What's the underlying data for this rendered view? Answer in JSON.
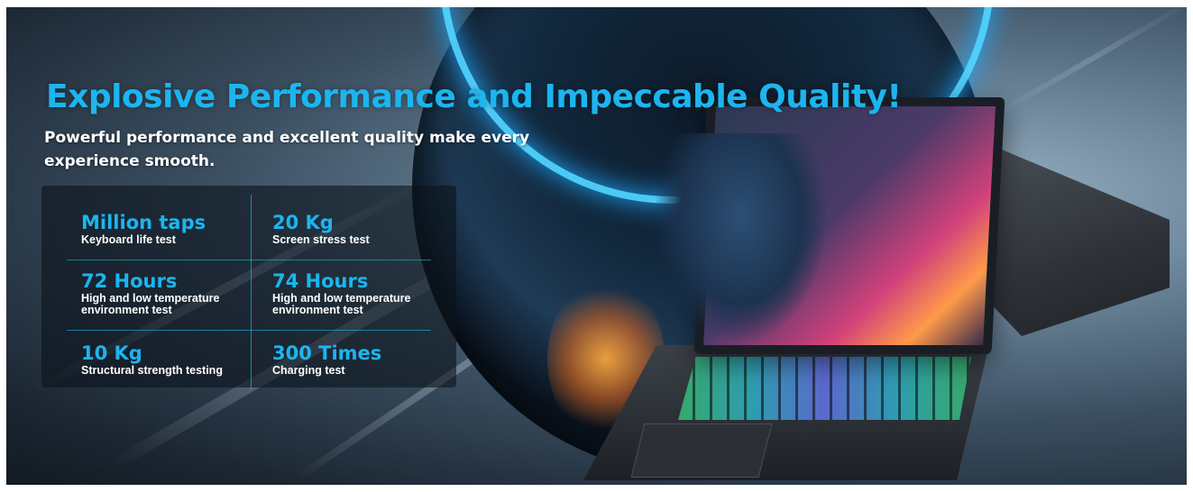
{
  "banner": {
    "headline": "Explosive Performance and Impeccable Quality!",
    "subheadline": "Powerful performance and excellent quality make every experience smooth.",
    "accent_color": "#1cb5ef",
    "text_color": "#ffffff"
  },
  "stats": [
    {
      "value": "Million taps",
      "label": "Keyboard life test"
    },
    {
      "value": "20 Kg",
      "label": "Screen stress test"
    },
    {
      "value": "72 Hours",
      "label": "High and low temperature environment test"
    },
    {
      "value": "74 Hours",
      "label": "High and low temperature environment test"
    },
    {
      "value": "10 Kg",
      "label": "Structural strength testing"
    },
    {
      "value": "300 Times",
      "label": "Charging test"
    }
  ]
}
